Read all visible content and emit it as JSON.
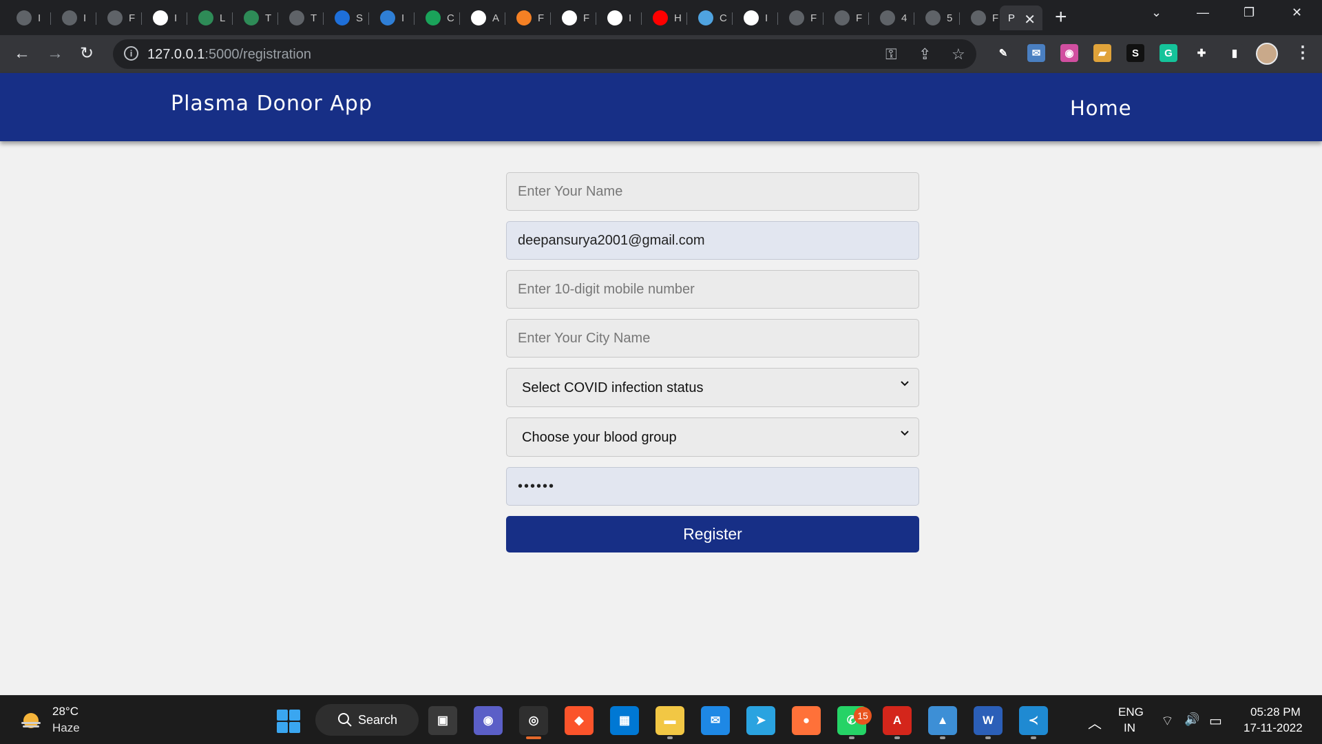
{
  "browser": {
    "tabs": [
      {
        "letter": "I",
        "icon": "globe-icon",
        "color": "#5f6368"
      },
      {
        "letter": "I",
        "icon": "github-icon",
        "color": "#5f6368"
      },
      {
        "letter": "F",
        "icon": "globe-icon",
        "color": "#5f6368"
      },
      {
        "letter": "I",
        "icon": "cube-icon",
        "color": "#ffffff"
      },
      {
        "letter": "L",
        "icon": "leaf-icon",
        "color": "#2e8b57"
      },
      {
        "letter": "T",
        "icon": "leaf-icon",
        "color": "#2e8b57"
      },
      {
        "letter": "T",
        "icon": "globe-icon",
        "color": "#5f6368"
      },
      {
        "letter": "S",
        "icon": "cloud-icon",
        "color": "#1e6fd9"
      },
      {
        "letter": "I",
        "icon": "bar-chart-icon",
        "color": "#2f7fd6"
      },
      {
        "letter": "C",
        "icon": "s-badge-icon",
        "color": "#1aa35a"
      },
      {
        "letter": "A",
        "icon": "google-icon",
        "color": "#ffffff"
      },
      {
        "letter": "F",
        "icon": "stackoverflow-icon",
        "color": "#f48024"
      },
      {
        "letter": "F",
        "icon": "google-icon",
        "color": "#ffffff"
      },
      {
        "letter": "I",
        "icon": "chrome-icon",
        "color": "#ffffff"
      },
      {
        "letter": "H",
        "icon": "youtube-icon",
        "color": "#ff0000"
      },
      {
        "letter": "C",
        "icon": "share-icon",
        "color": "#4fa3e0"
      },
      {
        "letter": "I",
        "icon": "chrome-icon",
        "color": "#ffffff"
      },
      {
        "letter": "F",
        "icon": "globe-icon",
        "color": "#5f6368"
      },
      {
        "letter": "F",
        "icon": "globe-icon",
        "color": "#5f6368"
      },
      {
        "letter": "4",
        "icon": "globe-icon",
        "color": "#5f6368"
      },
      {
        "letter": "5",
        "icon": "globe-icon",
        "color": "#5f6368"
      },
      {
        "letter": "F",
        "icon": "globe-icon",
        "color": "#5f6368"
      }
    ],
    "active_tab": {
      "letter": "P",
      "close": "✕"
    },
    "new_tab": "+",
    "window": {
      "tabsearch": "⌄",
      "minimize": "—",
      "restore": "❐",
      "close": "✕"
    },
    "nav": {
      "back": "←",
      "forward": "→",
      "reload": "↻"
    },
    "url_host": "127.0.0.1",
    "url_path": ":5000/registration",
    "omni_icons": {
      "key": "⚿",
      "share": "⇪",
      "star": "☆"
    },
    "extensions": [
      {
        "icon": "pen-icon",
        "label": "✎",
        "color": "#35363a"
      },
      {
        "icon": "mail-icon",
        "label": "✉",
        "color": "#4a7fc1"
      },
      {
        "icon": "color-wheel-icon",
        "label": "◉",
        "color": "#d14fa0"
      },
      {
        "icon": "folder-icon",
        "label": "▰",
        "color": "#e0a33a"
      },
      {
        "icon": "s-icon",
        "label": "S",
        "color": "#111111"
      },
      {
        "icon": "grammarly-icon",
        "label": "G",
        "color": "#15c39a"
      },
      {
        "icon": "puzzle-icon",
        "label": "✚",
        "color": "#35363a"
      },
      {
        "icon": "sidepanel-icon",
        "label": "▮",
        "color": "#35363a"
      }
    ],
    "menu": "⋮"
  },
  "app": {
    "brand": "Plasma Donor App",
    "nav_home": "Home",
    "accent": "#172f86"
  },
  "form": {
    "name_placeholder": "Enter Your Name",
    "email_value": "deepansurya2001@gmail.com",
    "mobile_placeholder": "Enter 10-digit mobile number",
    "city_placeholder": "Enter Your City Name",
    "covid_selected": "Select COVID infection status",
    "blood_selected": "Choose your blood group",
    "password_value": "••••••",
    "register_label": "Register"
  },
  "taskbar": {
    "weather_temp": "28°C",
    "weather_desc": "Haze",
    "search_label": "Search",
    "apps": [
      {
        "name": "task-view-icon",
        "glyph": "▣",
        "color": "#3a3a3a"
      },
      {
        "name": "teams-chat-icon",
        "glyph": "◉",
        "color": "#5b5fc7"
      },
      {
        "name": "chrome-icon",
        "glyph": "◎",
        "color": "#2f2f2f"
      },
      {
        "name": "brave-icon",
        "glyph": "◆",
        "color": "#fb542b"
      },
      {
        "name": "store-icon",
        "glyph": "▦",
        "color": "#0078d4"
      },
      {
        "name": "file-explorer-icon",
        "glyph": "▬",
        "color": "#f2c744"
      },
      {
        "name": "mail-icon",
        "glyph": "✉",
        "color": "#1e88e5"
      },
      {
        "name": "telegram-icon",
        "glyph": "➤",
        "color": "#2aa3e0"
      },
      {
        "name": "firefox-icon",
        "glyph": "●",
        "color": "#ff7139"
      },
      {
        "name": "whatsapp-icon",
        "glyph": "✆",
        "color": "#25d366"
      },
      {
        "name": "acrobat-icon",
        "glyph": "A",
        "color": "#d4261b"
      },
      {
        "name": "photos-icon",
        "glyph": "▲",
        "color": "#3d8fd6"
      },
      {
        "name": "word-icon",
        "glyph": "W",
        "color": "#2b5fb8"
      },
      {
        "name": "vscode-icon",
        "glyph": "≺",
        "color": "#1f8ad2"
      }
    ],
    "whatsapp_badge": "15",
    "tray_chevron": "︿",
    "lang_line1": "ENG",
    "lang_line2": "IN",
    "tray_wifi": "⌔",
    "tray_volume": "🔊",
    "tray_battery": "▭",
    "time": "05:28 PM",
    "date": "17-11-2022"
  }
}
